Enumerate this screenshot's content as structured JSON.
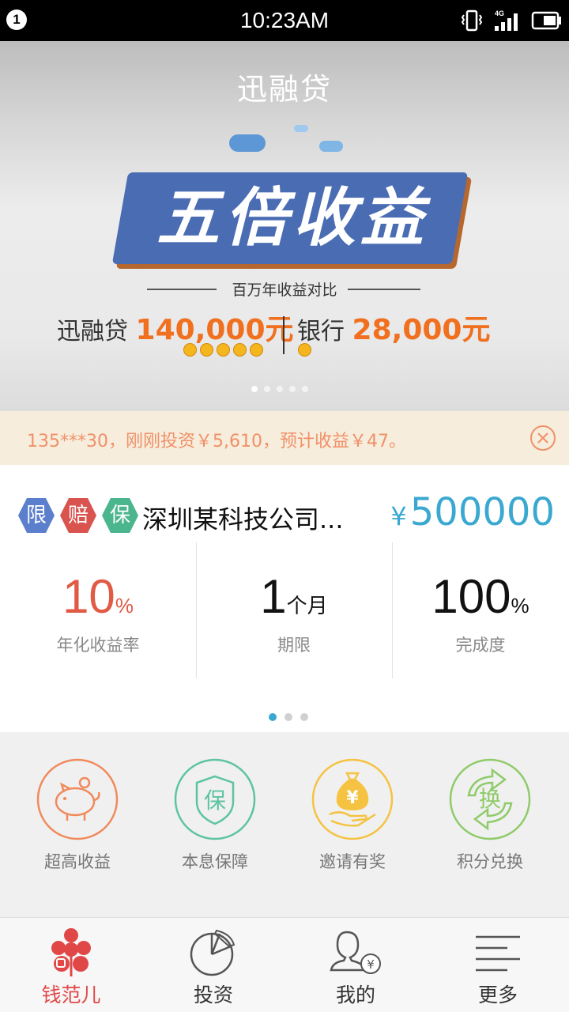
{
  "status_bar": {
    "notification_count": "1",
    "time": "10:23AM",
    "network": "4G"
  },
  "header": {
    "title": "迅融贷"
  },
  "banner": {
    "headline": "五倍收益",
    "subtitle": "百万年收益对比",
    "left_name": "迅融贷",
    "left_amount": "140,000元",
    "right_name": "银行",
    "right_amount": "28,000元",
    "page_count": 5,
    "active_page": 1
  },
  "notice": {
    "text": "135***30，刚刚投资￥5,610，预计收益￥47。"
  },
  "product": {
    "tags": [
      "限",
      "赔",
      "保"
    ],
    "tag_colors": [
      "#5b7fcc",
      "#d9534f",
      "#4bb58e"
    ],
    "title": "深圳某科技公司...",
    "currency": "¥",
    "amount": "500000",
    "stats": [
      {
        "value": "10",
        "unit": "%",
        "label": "年化收益率"
      },
      {
        "value": "1",
        "unit": "个月",
        "label": "期限"
      },
      {
        "value": "100",
        "unit": "%",
        "label": "完成度"
      }
    ],
    "page_count": 3,
    "active_page": 1
  },
  "features": [
    {
      "label": "超高收益",
      "icon": "piggy-bank-icon",
      "color": "#f08a5d"
    },
    {
      "label": "本息保障",
      "icon": "shield-icon",
      "color": "#5cc4a2",
      "glyph": "保"
    },
    {
      "label": "邀请有奖",
      "icon": "money-bag-icon",
      "color": "#f5c242",
      "glyph": "¥"
    },
    {
      "label": "积分兑换",
      "icon": "exchange-icon",
      "color": "#8fcb6a",
      "glyph": "换"
    }
  ],
  "tabbar": {
    "items": [
      {
        "label": "钱范儿",
        "icon": "flower-logo-icon",
        "active": true
      },
      {
        "label": "投资",
        "icon": "pie-chart-icon",
        "active": false
      },
      {
        "label": "我的",
        "icon": "user-yen-icon",
        "active": false
      },
      {
        "label": "更多",
        "icon": "menu-lines-icon",
        "active": false
      }
    ],
    "active_color": "#e04848"
  }
}
